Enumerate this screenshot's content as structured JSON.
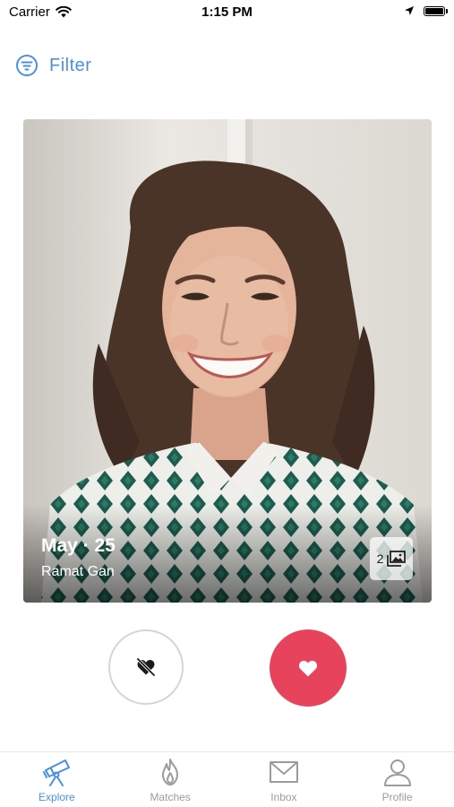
{
  "status_bar": {
    "carrier": "Carrier",
    "time": "1:15 PM"
  },
  "filter": {
    "label": "Filter"
  },
  "card": {
    "name": "May · 25",
    "location": "Ramat Gan",
    "photo_count": "2"
  },
  "actions": {
    "dislike_icon": "heart-slash-icon",
    "like_icon": "heart-icon"
  },
  "tabs": [
    {
      "label": "Explore",
      "icon": "telescope-icon",
      "active": true
    },
    {
      "label": "Matches",
      "icon": "flame-icon",
      "active": false
    },
    {
      "label": "Inbox",
      "icon": "mail-icon",
      "active": false
    },
    {
      "label": "Profile",
      "icon": "person-icon",
      "active": false
    }
  ],
  "colors": {
    "accent": "#4a90e2",
    "like": "#e8435c",
    "inactive": "#9b9b9b"
  }
}
